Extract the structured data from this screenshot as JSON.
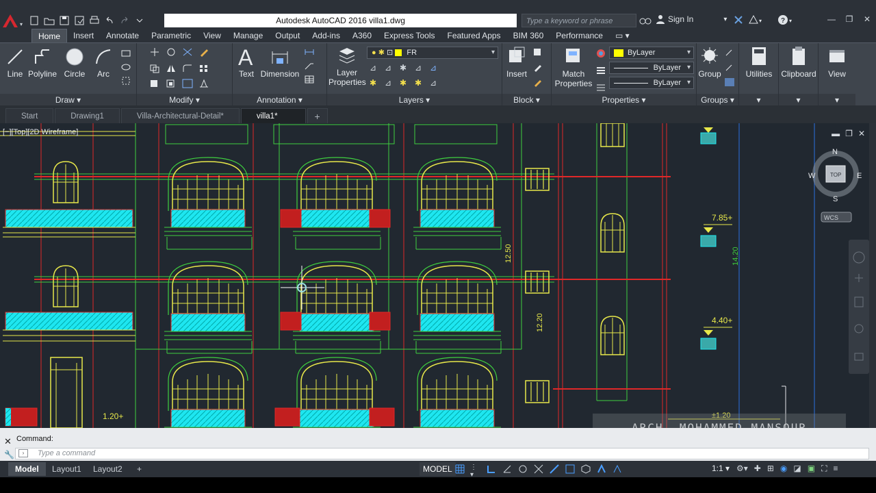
{
  "window": {
    "title": "Autodesk AutoCAD 2016   villa1.dwg",
    "search_placeholder": "Type a keyword or phrase",
    "signin": "Sign In"
  },
  "ribbon_tabs": [
    "Home",
    "Insert",
    "Annotate",
    "Parametric",
    "View",
    "Manage",
    "Output",
    "Add-ins",
    "A360",
    "Express Tools",
    "Featured Apps",
    "BIM 360",
    "Performance"
  ],
  "draw": {
    "line": "Line",
    "polyline": "Polyline",
    "circle": "Circle",
    "arc": "Arc",
    "footer": "Draw"
  },
  "modify": {
    "footer": "Modify"
  },
  "annotation": {
    "text": "Text",
    "dimension": "Dimension",
    "footer": "Annotation"
  },
  "layers": {
    "layer_properties_1": "Layer",
    "layer_properties_2": "Properties",
    "current_layer": "FR",
    "footer": "Layers"
  },
  "block": {
    "insert": "Insert",
    "footer": "Block"
  },
  "properties": {
    "match_1": "Match",
    "match_2": "Properties",
    "color": "ByLayer",
    "linetype": "ByLayer",
    "lineweight": "ByLayer",
    "footer": "Properties"
  },
  "groups": {
    "group": "Group",
    "footer": "Groups"
  },
  "utilities": {
    "label": "Utilities"
  },
  "clipboard": {
    "label": "Clipboard"
  },
  "view": {
    "label": "View"
  },
  "file_tabs": [
    "Start",
    "Drawing1",
    "Villa-Architectural-Detail*",
    "villa1*"
  ],
  "viewport": {
    "label": "[−][Top][2D Wireframe]",
    "viewcube": {
      "n": "N",
      "s": "S",
      "e": "E",
      "w": "W",
      "top": "TOP",
      "wcs": "WCS"
    },
    "dimensions": [
      "12.50",
      "12.20",
      "14.20"
    ],
    "levels": [
      "7.85+",
      "4.40+",
      "1.20+",
      "±1.20"
    ],
    "watermark": "ARCH. MOHAMMED MANSOUR"
  },
  "command": {
    "history": "Command:",
    "placeholder": "Type a command"
  },
  "layout_tabs": [
    "Model",
    "Layout1",
    "Layout2"
  ],
  "status": {
    "model": "MODEL",
    "scale": "1:1"
  }
}
